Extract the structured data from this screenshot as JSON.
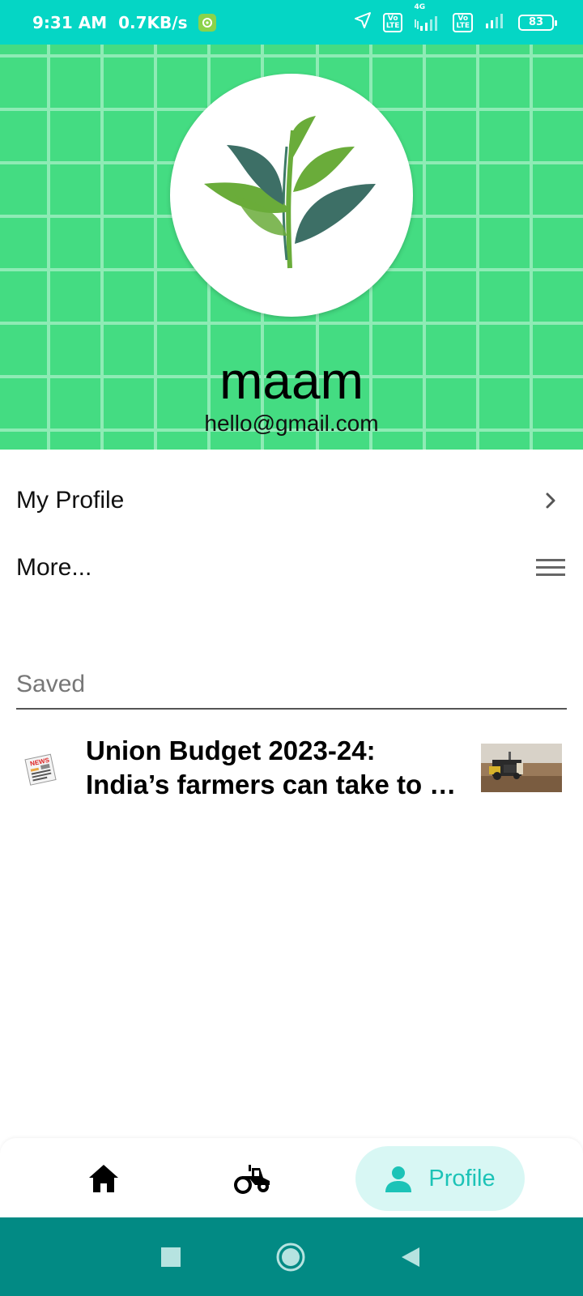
{
  "status_bar": {
    "time": "9:31 AM",
    "speed": "0.7KB/s",
    "network": "4G",
    "lte_label": "Vo LTE",
    "battery": "83"
  },
  "profile": {
    "name": "maam",
    "email": "hello@gmail.com"
  },
  "menu": {
    "my_profile": "My Profile",
    "more": "More..."
  },
  "saved": {
    "header": "Saved",
    "items": [
      {
        "title_line1": "Union Budget 2023-24:",
        "title_line2": "India’s farmers can take to …",
        "news_icon_label": "NEWS"
      }
    ]
  },
  "bottom_nav": {
    "home_icon": "home-icon",
    "tractor_icon": "tractor-icon",
    "profile_label": "Profile",
    "active": "Profile"
  },
  "colors": {
    "status_bar": "#05d6c5",
    "header_bg": "#44dc82",
    "accent": "#1cc3b7",
    "system_nav": "#028a84"
  }
}
